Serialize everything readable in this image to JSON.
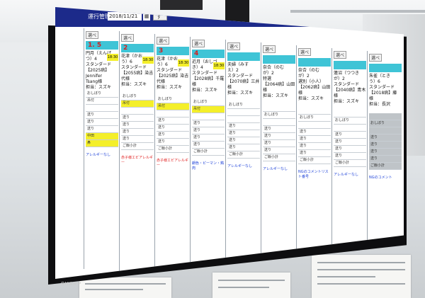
{
  "app": {
    "title": "運行管理",
    "date": "2018/11/21",
    "date_button": "▦",
    "go_button": "ﾀﾞ"
  },
  "columns": [
    {
      "head": "選べ",
      "room": "1. 5",
      "patient": [
        "円月（えんげ",
        "つ）4",
        "スタンダード",
        "【2025病】Jennifer",
        "Tsang様",
        "担当：スズキ"
      ],
      "time": "18:30",
      "rows": [
        "おしぼり",
        "吊付",
        "",
        "送り",
        "送り",
        "送り",
        "中田",
        "鼻"
      ],
      "yellow": [
        6,
        7
      ],
      "note": "アレルギーなし"
    },
    {
      "head": "選べ",
      "room": "2",
      "patient": [
        "花津（かお",
        "う）6",
        "スタンダード",
        "【2055病】染吉",
        "代様",
        "担当：スズキ"
      ],
      "time": "18:30",
      "rows": [
        "おしぼり",
        "吊付",
        "",
        "送り",
        "送り",
        "送り",
        "送り",
        "ご飯小計"
      ],
      "yellow": [
        1
      ],
      "note": "赤子様エビアレルギー"
    },
    {
      "head": "選べ",
      "room": "3",
      "patient": [
        "花津（かお",
        "う）6",
        "スタンダード",
        "【2025病】染吉",
        "代様",
        "担当：スズキ"
      ],
      "time": "18:30",
      "rows": [
        "おしぼり",
        "吊付",
        "",
        "送り",
        "送り",
        "送り",
        "送り",
        "ご飯小計"
      ],
      "yellow": [
        1
      ],
      "note": "赤子様エビアレルギー"
    },
    {
      "head": "選べ",
      "room": "4",
      "patient": [
        "近月（おしづ",
        "き）4",
        "スタンダード",
        "【2028病】千羅",
        "様",
        "担当：スズキ"
      ],
      "time": "18:30",
      "rows": [
        "おしぼり",
        "吊付",
        "",
        "送り",
        "送り",
        "送り",
        "送り",
        "ご飯小計"
      ],
      "yellow": [
        1
      ],
      "note": "朗色・ピーマン・鶏肉"
    },
    {
      "head": "選べ",
      "room": "",
      "patient": [
        "夫婦（みす",
        "え）2",
        "スタンダード",
        "【2070病】三井",
        "様",
        "担当：スズキ"
      ],
      "time": "",
      "rows": [
        "おしぼり",
        "",
        "",
        "送り",
        "送り",
        "送り",
        "送り",
        "ご飯小計"
      ],
      "yellow": [],
      "note": "アレルギーなし"
    },
    {
      "head": "選べ",
      "room": "",
      "patient": [
        "奈合（のむ",
        "が）2",
        "特選",
        "【2064病】山田",
        "様",
        "担当：スズキ"
      ],
      "time": "",
      "rows": [
        "",
        "おしぼり",
        "",
        "送り",
        "送り",
        "送り",
        "送り",
        "ご飯小計"
      ],
      "yellow": [],
      "note": "アレルギーなし"
    },
    {
      "head": "選べ",
      "room": "",
      "patient": [
        "奈合（のむ",
        "が）2",
        "選別（小人）",
        "【2062病】山田",
        "様",
        "担当：スズキ"
      ],
      "time": "",
      "rows": [
        "",
        "おしぼり",
        "",
        "送り",
        "送り",
        "送り",
        "送り",
        "ご飯小計"
      ],
      "yellow": [],
      "note": "NGのコメントリスト番号"
    },
    {
      "head": "選べ",
      "room": "",
      "patient": [
        "蓮沼（つつき",
        "が）2",
        "スタンダード",
        "【2040病】青木",
        "様",
        "担当：スズキ"
      ],
      "time": "",
      "rows": [
        "",
        "おしぼり",
        "",
        "送り",
        "送り",
        "送り",
        "送り",
        "ご飯小計"
      ],
      "yellow": [],
      "note": "アレルギーなし"
    },
    {
      "head": "選べ",
      "room": "",
      "patient": [
        "朱雀（とき",
        "う）6",
        "スタンダード",
        "【2018病】藤",
        "様",
        "担当：長沢"
      ],
      "time": "",
      "rows": [
        "",
        "おしぼり",
        "",
        "送り",
        "送り",
        "送り",
        "送り",
        "ご飯小計"
      ],
      "yellow": [],
      "note": "NGのコメント"
    }
  ],
  "brand": "SHARP"
}
